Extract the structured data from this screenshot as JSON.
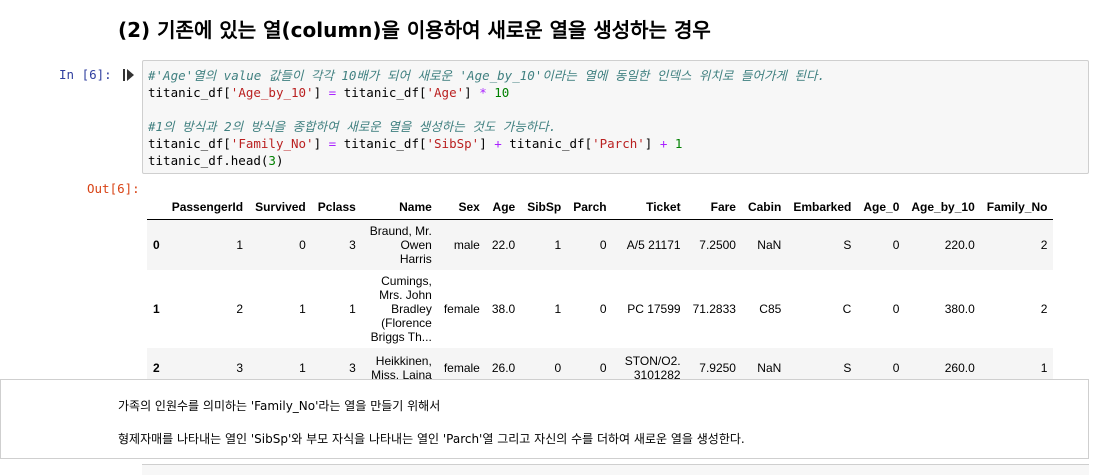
{
  "heading": "(2) 기존에 있는 열(column)을 이용하여 새로운 열을 생성하는 경우",
  "in_prompt": "In [6]:",
  "out_prompt": "Out[6]:",
  "code": {
    "comment1": "#'Age'열의 value 값들이 각각 10배가 되어 새로운 'Age_by_10'이라는 열에 동일한 인덱스 위치로 들어가게 된다.",
    "l2_a": "titanic_df[",
    "l2_s1": "'Age_by_10'",
    "l2_b": "] ",
    "l2_eq": "=",
    "l2_c": " titanic_df[",
    "l2_s2": "'Age'",
    "l2_d": "] ",
    "l2_mul": "*",
    "l2_num": " 10",
    "comment2": "#1의 방식과 2의 방식을 종합하여 새로운 열을 생성하는 것도 가능하다.",
    "l5_a": "titanic_df[",
    "l5_s1": "'Family_No'",
    "l5_b": "] ",
    "l5_eq": "=",
    "l5_c": " titanic_df[",
    "l5_s2": "'SibSp'",
    "l5_d": "] ",
    "l5_plus1": "+",
    "l5_e": " titanic_df[",
    "l5_s3": "'Parch'",
    "l5_f": "] ",
    "l5_plus2": "+",
    "l5_num": " 1",
    "l6_a": "titanic_df.head(",
    "l6_num": "3",
    "l6_b": ")"
  },
  "table": {
    "columns": [
      "",
      "PassengerId",
      "Survived",
      "Pclass",
      "Name",
      "Sex",
      "Age",
      "SibSp",
      "Parch",
      "Ticket",
      "Fare",
      "Cabin",
      "Embarked",
      "Age_0",
      "Age_by_10",
      "Family_No"
    ],
    "rows": [
      [
        "0",
        "1",
        "0",
        "3",
        "Braund, Mr. Owen Harris",
        "male",
        "22.0",
        "1",
        "0",
        "A/5 21171",
        "7.2500",
        "NaN",
        "S",
        "0",
        "220.0",
        "2"
      ],
      [
        "1",
        "2",
        "1",
        "1",
        "Cumings, Mrs. John Bradley (Florence Briggs Th...",
        "female",
        "38.0",
        "1",
        "0",
        "PC 17599",
        "71.2833",
        "C85",
        "C",
        "0",
        "380.0",
        "2"
      ],
      [
        "2",
        "3",
        "1",
        "3",
        "Heikkinen, Miss. Laina",
        "female",
        "26.0",
        "0",
        "0",
        "STON/O2. 3101282",
        "7.9250",
        "NaN",
        "S",
        "0",
        "260.0",
        "1"
      ]
    ]
  },
  "markdown": {
    "line1": "가족의 인원수를 의미하는 'Family_No'라는 열을 만들기 위해서",
    "line2": "형제자매를 나타내는 열인 'SibSp'와 부모 자식을 나타내는 열인 'Parch'열 그리고 자신의 수를 더하여 새로운 열을 생성한다."
  }
}
